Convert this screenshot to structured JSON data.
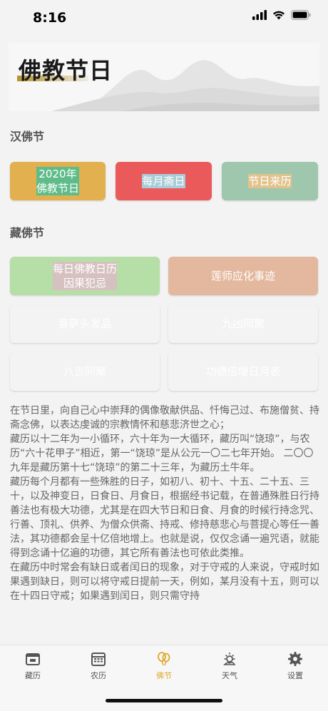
{
  "status": {
    "time": "8:16"
  },
  "banner": {
    "title": "佛教节日"
  },
  "han_section": {
    "title": "汉佛节",
    "buttons": [
      {
        "label": "2020年\n佛教节日",
        "color": "#e2b04f"
      },
      {
        "label": "每月斋日",
        "color": "#5fbc8a"
      },
      {
        "label": "节日来历",
        "color": "#eb5a5a"
      }
    ]
  },
  "zang_section": {
    "title": "藏佛节",
    "buttons": [
      {
        "label": "每日佛教日历\n因果犯忌",
        "color": "#a8ccd8"
      },
      {
        "label": "莲师应化事迹",
        "color": "#9fc7ad"
      },
      {
        "label": "菩萨头发品",
        "color": "#e2c38e"
      },
      {
        "label": "九凶同聚",
        "color": "#b6dfa8"
      },
      {
        "label": "八吉同聚",
        "color": "#d6c0c0"
      },
      {
        "label": "功德倍增日月表",
        "color": "#e3b89e"
      }
    ]
  },
  "description": [
    "在节日里，向自己心中崇拜的偶像敬献供品、忏悔己过、布施僧贫、持斋念佛，以表达虔诚的宗教情怀和慈悲济世之心；",
    "藏历以十二年为一小循环，六十年为一大循环，藏历叫“饶琼”，与农历“六十花甲子”相近，第一“饶琼”是从公元一〇二七年开始。 二〇〇九年是藏历第十七“饶琼”的第二十三年，为藏历土牛年。",
    "藏历每个月都有一些殊胜的日子，如初八、初十、十五、二十五、三十，以及神变日，日食日、月食日，根据经书记载，在普通殊胜日行持善法也有极大功德，尤其是在四大节日和日食、月食的时候行持念咒、行善、顶礼、供养、为僧众供斋、持戒、修持慈悲心与菩提心等任一善法，其功德都会呈十亿倍地增上。也就是说，仅仅念诵一遍咒语，就能得到念诵十亿遍的功德，其它所有善法也可依此类推。",
    "在藏历中时常会有缺日或者闰日的现象，对于守戒的人来说，守戒时如果遇到缺日，则可以将守戒日提前一天，例如，某月没有十五，则可以在十四日守戒；如果遇到闰日，则只需守持"
  ],
  "tabs": [
    {
      "label": "藏历",
      "icon": "calendar-box-icon",
      "active": false
    },
    {
      "label": "农历",
      "icon": "calendar-grid-icon",
      "active": false
    },
    {
      "label": "佛节",
      "icon": "balloon-icon",
      "active": true
    },
    {
      "label": "天气",
      "icon": "weather-icon",
      "active": false
    },
    {
      "label": "设置",
      "icon": "gear-icon",
      "active": false
    }
  ]
}
